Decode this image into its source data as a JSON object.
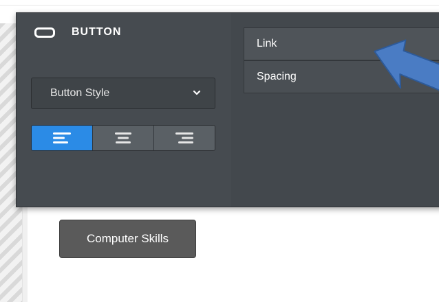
{
  "panel": {
    "title": "BUTTON",
    "title_icon": "button-shape-icon",
    "style_select": {
      "value": "Button Style"
    },
    "alignment": {
      "options": [
        "align-left-icon",
        "align-center-icon",
        "align-right-icon"
      ],
      "active": "align-left-icon"
    },
    "tabs": [
      {
        "label": "Link"
      },
      {
        "label": "Spacing"
      }
    ]
  },
  "page": {
    "button_label": "Computer Skills"
  },
  "colors": {
    "panel_bg": "#464b50",
    "active_accent": "#2b8be6",
    "pointer_arrow": "#4a7cc4",
    "page_button": "#5a5a5a"
  }
}
